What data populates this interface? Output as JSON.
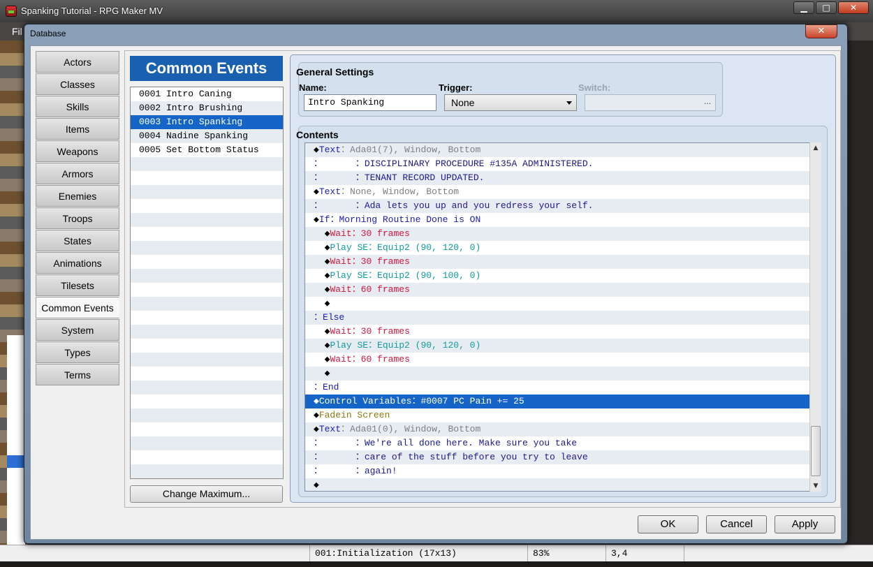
{
  "app": {
    "title": "Spanking Tutorial - RPG Maker MV",
    "menu_first": "Fil",
    "window_buttons": [
      "minimize-icon",
      "maximize-icon",
      "close-icon"
    ]
  },
  "status_bar": {
    "map": "001:Initialization (17x13)",
    "zoom": "83%",
    "coords": "3,4"
  },
  "dialog": {
    "title": "Database",
    "categories": [
      "Actors",
      "Classes",
      "Skills",
      "Items",
      "Weapons",
      "Armors",
      "Enemies",
      "Troops",
      "States",
      "Animations",
      "Tilesets",
      "Common Events",
      "System",
      "Types",
      "Terms"
    ],
    "active_category": "Common Events",
    "list_header": "Common Events",
    "events": [
      "0001 Intro Caning",
      "0002 Intro Brushing",
      "0003 Intro Spanking",
      "0004 Nadine Spanking",
      "0005 Set Bottom Status"
    ],
    "selected_event_index": 2,
    "change_maximum_label": "Change Maximum...",
    "general": {
      "heading": "General Settings",
      "name_label": "Name:",
      "name_value": "Intro Spanking",
      "trigger_label": "Trigger:",
      "trigger_value": "None",
      "switch_label": "Switch:",
      "switch_button": "..."
    },
    "contents_heading": "Contents",
    "commands": [
      [
        {
          "t": "◆",
          "c": "diamond"
        },
        {
          "t": "Text",
          "c": "c-blue"
        },
        {
          "t": "：Ada01(7), Window, Bottom",
          "c": "c-gray"
        }
      ],
      [
        {
          "t": "：      ：",
          "c": "c-navy"
        },
        {
          "t": "DISCIPLINARY PROCEDURE #135A ADMINISTERED.",
          "c": "c-navy"
        }
      ],
      [
        {
          "t": "：      ：",
          "c": "c-navy"
        },
        {
          "t": "TENANT RECORD UPDATED.",
          "c": "c-navy"
        }
      ],
      [
        {
          "t": "◆",
          "c": "diamond"
        },
        {
          "t": "Text",
          "c": "c-blue"
        },
        {
          "t": "：None, Window, Bottom",
          "c": "c-gray"
        }
      ],
      [
        {
          "t": "：      ：",
          "c": "c-navy"
        },
        {
          "t": "Ada lets you up and you redress your self.",
          "c": "c-navy"
        }
      ],
      [
        {
          "t": "◆",
          "c": "diamond"
        },
        {
          "t": "If",
          "c": "c-blue"
        },
        {
          "t": "：Morning Routine Done is ON",
          "c": "c-blue"
        }
      ],
      [
        {
          "t": "  ◆",
          "c": "diamond"
        },
        {
          "t": "Wait",
          "c": "c-red"
        },
        {
          "t": "：30 frames",
          "c": "c-red"
        }
      ],
      [
        {
          "t": "  ◆",
          "c": "diamond"
        },
        {
          "t": "Play SE",
          "c": "c-teal"
        },
        {
          "t": "：Equip2 (90, 120, 0)",
          "c": "c-teal"
        }
      ],
      [
        {
          "t": "  ◆",
          "c": "diamond"
        },
        {
          "t": "Wait",
          "c": "c-red"
        },
        {
          "t": "：30 frames",
          "c": "c-red"
        }
      ],
      [
        {
          "t": "  ◆",
          "c": "diamond"
        },
        {
          "t": "Play SE",
          "c": "c-teal"
        },
        {
          "t": "：Equip2 (90, 100, 0)",
          "c": "c-teal"
        }
      ],
      [
        {
          "t": "  ◆",
          "c": "diamond"
        },
        {
          "t": "Wait",
          "c": "c-red"
        },
        {
          "t": "：60 frames",
          "c": "c-red"
        }
      ],
      [
        {
          "t": "  ◆",
          "c": "diamond"
        }
      ],
      [
        {
          "t": "：",
          "c": "c-blue"
        },
        {
          "t": "Else",
          "c": "c-blue"
        }
      ],
      [
        {
          "t": "  ◆",
          "c": "diamond"
        },
        {
          "t": "Wait",
          "c": "c-red"
        },
        {
          "t": "：30 frames",
          "c": "c-red"
        }
      ],
      [
        {
          "t": "  ◆",
          "c": "diamond"
        },
        {
          "t": "Play SE",
          "c": "c-teal"
        },
        {
          "t": "：Equip2 (90, 120, 0)",
          "c": "c-teal"
        }
      ],
      [
        {
          "t": "  ◆",
          "c": "diamond"
        },
        {
          "t": "Wait",
          "c": "c-red"
        },
        {
          "t": "：60 frames",
          "c": "c-red"
        }
      ],
      [
        {
          "t": "  ◆",
          "c": "diamond"
        }
      ],
      [
        {
          "t": "：",
          "c": "c-blue"
        },
        {
          "t": "End",
          "c": "c-blue"
        }
      ],
      [
        {
          "t": "◆",
          "c": "diamond"
        },
        {
          "t": "Control Variables",
          "c": "c-blue"
        },
        {
          "t": "：#0007 PC Pain += 25",
          "c": "c-blue"
        }
      ],
      [
        {
          "t": "◆",
          "c": "diamond"
        },
        {
          "t": "Fadein Screen",
          "c": "c-olive"
        }
      ],
      [
        {
          "t": "◆",
          "c": "diamond"
        },
        {
          "t": "Text",
          "c": "c-blue"
        },
        {
          "t": "：Ada01(0), Window, Bottom",
          "c": "c-gray"
        }
      ],
      [
        {
          "t": "：      ：",
          "c": "c-navy"
        },
        {
          "t": "We're all done here. Make sure you take",
          "c": "c-navy"
        }
      ],
      [
        {
          "t": "：      ：",
          "c": "c-navy"
        },
        {
          "t": "care of the stuff before you try to leave",
          "c": "c-navy"
        }
      ],
      [
        {
          "t": "：      ：",
          "c": "c-navy"
        },
        {
          "t": "again!",
          "c": "c-navy"
        }
      ],
      [
        {
          "t": "◆",
          "c": "diamond"
        }
      ]
    ],
    "selected_command_index": 18,
    "buttons": {
      "ok": "OK",
      "cancel": "Cancel",
      "apply": "Apply"
    }
  }
}
